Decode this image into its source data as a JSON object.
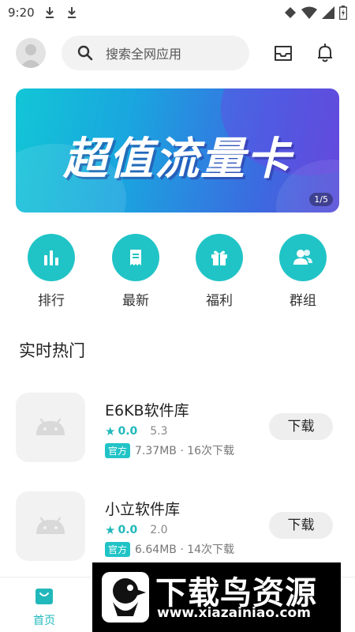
{
  "status_bar": {
    "time": "9:20"
  },
  "search": {
    "placeholder": "搜索全网应用"
  },
  "banner": {
    "title": "超值流量卡",
    "pager": "1/5"
  },
  "categories": [
    {
      "label": "排行",
      "icon": "bar-chart-icon"
    },
    {
      "label": "最新",
      "icon": "receipt-icon"
    },
    {
      "label": "福利",
      "icon": "gift-icon"
    },
    {
      "label": "群组",
      "icon": "group-icon"
    }
  ],
  "section": {
    "title": "实时热门"
  },
  "apps": [
    {
      "name": "E6KB软件库",
      "rating": "0.0",
      "version": "5.3",
      "badge": "官方",
      "meta": "7.37MB · 16次下载",
      "button": "下载"
    },
    {
      "name": "小立软件库",
      "rating": "0.0",
      "version": "2.0",
      "badge": "官方",
      "meta": "6.64MB · 14次下载",
      "button": "下载"
    }
  ],
  "bottom_nav": {
    "home_label": "首页"
  },
  "watermark": {
    "title": "下载鸟资源",
    "url": "www.xiazainiao.com"
  },
  "colors": {
    "accent": "#21c4c6",
    "accent_text": "#21b8bb"
  }
}
